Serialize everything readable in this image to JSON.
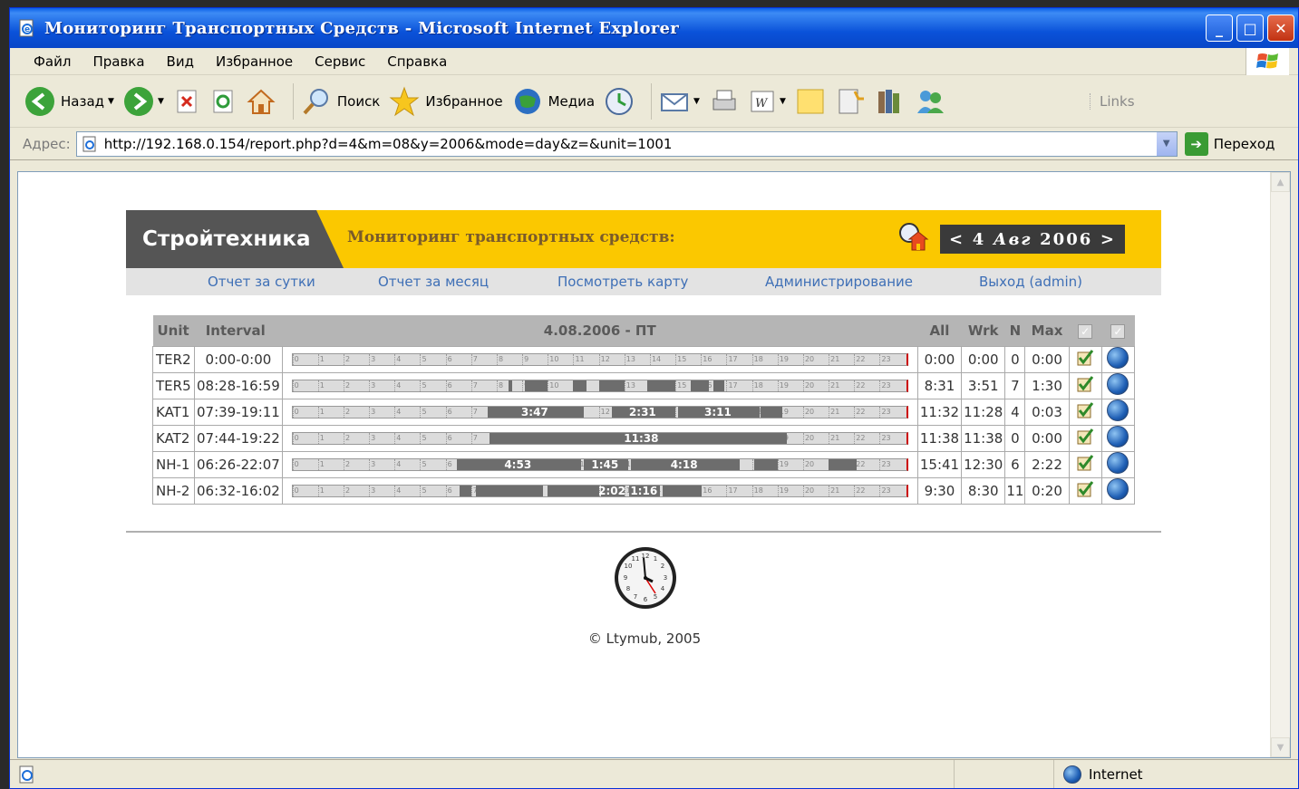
{
  "window": {
    "title": "Мониторинг Транспортных Средств - Microsoft Internet Explorer",
    "controls": {
      "minimize": "_",
      "maximize": "□",
      "close": "✕"
    }
  },
  "menu": [
    "Файл",
    "Правка",
    "Вид",
    "Избранное",
    "Сервис",
    "Справка"
  ],
  "toolbar": {
    "back": "Назад",
    "search": "Поиск",
    "favorites": "Избранное",
    "media": "Медиа",
    "links": "Links"
  },
  "address": {
    "label": "Адрес:",
    "url": "http://192.168.0.154/report.php?d=4&m=08&y=2006&mode=day&z=&unit=1001",
    "go": "Переход"
  },
  "site": {
    "brand": "Стройтехника",
    "subtitle": "Мониторинг транспортных средств:",
    "date_nav": {
      "prev": "<",
      "day": "4",
      "month": "Авг",
      "year": "2006",
      "next": ">"
    },
    "nav": [
      "Отчет за сутки",
      "Отчет за месяц",
      "Посмотреть карту",
      "Администрирование",
      "Выход (admin)"
    ]
  },
  "report": {
    "headers": {
      "unit": "Unit",
      "interval": "Interval",
      "date": "4.08.2006 - ПТ",
      "all": "All",
      "wrk": "Wrk",
      "n": "N",
      "max": "Max"
    },
    "rows": [
      {
        "unit": "TER2",
        "interval": "0:00-0:00",
        "all": "0:00",
        "wrk": "0:00",
        "n": "0",
        "max": "0:00",
        "segments": []
      },
      {
        "unit": "TER5",
        "interval": "08:28-16:59",
        "all": "8:31",
        "wrk": "3:51",
        "n": "7",
        "max": "1:30",
        "segments": [
          {
            "start": 8.45,
            "end": 8.6,
            "label": ""
          },
          {
            "start": 9.1,
            "end": 10.0,
            "label": ""
          },
          {
            "start": 11.0,
            "end": 11.5,
            "label": ""
          },
          {
            "start": 12.0,
            "end": 13.0,
            "label": ""
          },
          {
            "start": 13.9,
            "end": 15.0,
            "label": ""
          },
          {
            "start": 15.6,
            "end": 16.3,
            "label": ""
          },
          {
            "start": 16.5,
            "end": 16.9,
            "label": ""
          }
        ]
      },
      {
        "unit": "KAT1",
        "interval": "07:39-19:11",
        "all": "11:32",
        "wrk": "11:28",
        "n": "4",
        "max": "0:03",
        "segments": [
          {
            "start": 7.65,
            "end": 11.4,
            "label": "3:47"
          },
          {
            "start": 12.5,
            "end": 15.0,
            "label": "2:31"
          },
          {
            "start": 15.1,
            "end": 18.3,
            "label": "3:11"
          },
          {
            "start": 18.35,
            "end": 19.18,
            "label": ""
          }
        ]
      },
      {
        "unit": "KAT2",
        "interval": "07:44-19:22",
        "all": "11:38",
        "wrk": "11:38",
        "n": "0",
        "max": "0:00",
        "segments": [
          {
            "start": 7.73,
            "end": 19.37,
            "label": "11:38"
          }
        ]
      },
      {
        "unit": "NH-1",
        "interval": "06:26-22:07",
        "all": "15:41",
        "wrk": "12:30",
        "n": "6",
        "max": "2:22",
        "segments": [
          {
            "start": 6.43,
            "end": 11.3,
            "label": "4:53"
          },
          {
            "start": 11.4,
            "end": 13.15,
            "label": "1:45"
          },
          {
            "start": 13.25,
            "end": 17.5,
            "label": "4:18"
          },
          {
            "start": 18.1,
            "end": 19.0,
            "label": ""
          },
          {
            "start": 21.0,
            "end": 22.1,
            "label": ""
          }
        ]
      },
      {
        "unit": "NH-2",
        "interval": "06:32-16:02",
        "all": "9:30",
        "wrk": "8:30",
        "n": "11",
        "max": "0:20",
        "segments": [
          {
            "start": 6.53,
            "end": 7.0,
            "label": ""
          },
          {
            "start": 7.2,
            "end": 9.8,
            "label": ""
          },
          {
            "start": 10.0,
            "end": 12.0,
            "label": ""
          },
          {
            "start": 12.1,
            "end": 13.0,
            "label": "2:02"
          },
          {
            "start": 13.2,
            "end": 14.4,
            "label": "1:16"
          },
          {
            "start": 14.5,
            "end": 16.03,
            "label": ""
          }
        ]
      }
    ]
  },
  "footer": {
    "copyright": "© Ltymub, 2005"
  },
  "status": {
    "zone": "Internet"
  },
  "colors": {
    "accent_yellow": "#fbc800",
    "brand_dark": "#555555",
    "link": "#3e6fb6",
    "bar_work": "#6d6d6d"
  }
}
